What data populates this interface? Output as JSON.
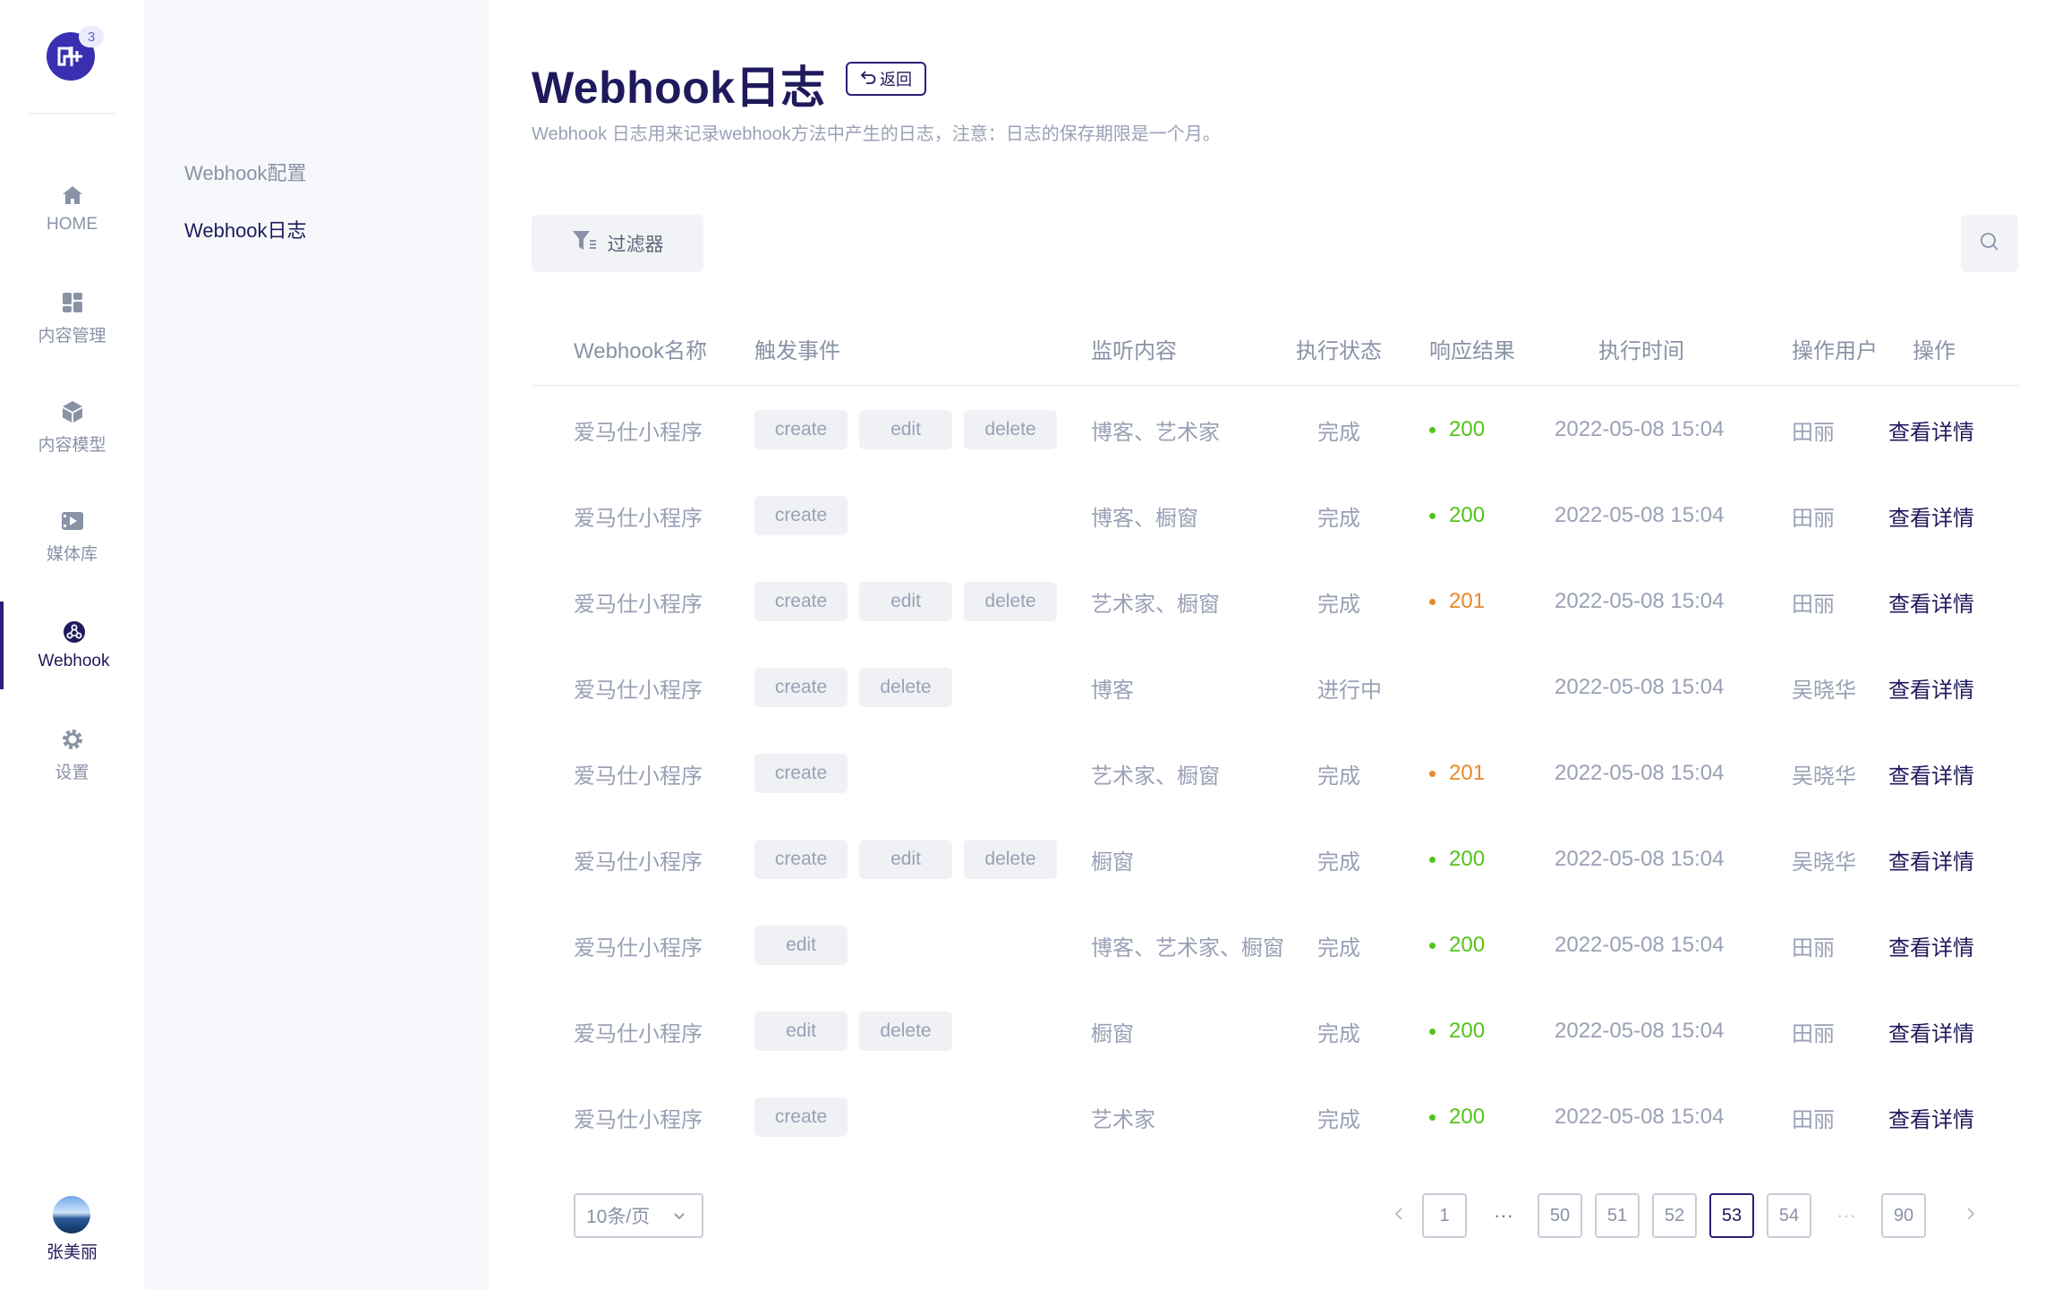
{
  "app": {
    "notification_count": "3",
    "colors": {
      "primary": "#2a1f7a",
      "success": "#52c41a",
      "warning": "#e8892b",
      "muted": "#9aa1b5"
    }
  },
  "rail": {
    "items": [
      {
        "label": "HOME",
        "icon": "home-icon"
      },
      {
        "label": "内容管理",
        "icon": "dashboard-icon"
      },
      {
        "label": "内容模型",
        "icon": "cube-icon"
      },
      {
        "label": "媒体库",
        "icon": "media-icon"
      },
      {
        "label": "Webhook",
        "icon": "webhook-icon",
        "active": true
      },
      {
        "label": "设置",
        "icon": "gear-icon"
      }
    ],
    "user_name": "张美丽"
  },
  "subnav": {
    "items": [
      {
        "label": "Webhook配置"
      },
      {
        "label": "Webhook日志",
        "active": true
      }
    ]
  },
  "header": {
    "title": "Webhook日志",
    "back_label": "返回",
    "subtitle": "Webhook 日志用来记录webhook方法中产生的日志，注意：日志的保存期限是一个月。"
  },
  "toolbar": {
    "filter_label": "过滤器",
    "search_icon": "search-icon"
  },
  "table": {
    "columns": [
      "Webhook名称",
      "触发事件",
      "监听内容",
      "执行状态",
      "响应结果",
      "执行时间",
      "操作用户",
      "操作"
    ],
    "rows": [
      {
        "name": "爱马仕小程序",
        "events": [
          "create",
          "edit",
          "delete"
        ],
        "content": "博客、艺术家",
        "status": "完成",
        "result": "200",
        "result_color": "#52c41a",
        "time": "2022-05-08 15:04",
        "user": "田丽",
        "action": "查看详情"
      },
      {
        "name": "爱马仕小程序",
        "events": [
          "create"
        ],
        "content": "博客、橱窗",
        "status": "完成",
        "result": "200",
        "result_color": "#52c41a",
        "time": "2022-05-08 15:04",
        "user": "田丽",
        "action": "查看详情"
      },
      {
        "name": "爱马仕小程序",
        "events": [
          "create",
          "edit",
          "delete"
        ],
        "content": "艺术家、橱窗",
        "status": "完成",
        "result": "201",
        "result_color": "#e8892b",
        "time": "2022-05-08 15:04",
        "user": "田丽",
        "action": "查看详情"
      },
      {
        "name": "爱马仕小程序",
        "events": [
          "create",
          "delete"
        ],
        "content": "博客",
        "status": "进行中",
        "result": "",
        "result_color": "",
        "time": "2022-05-08 15:04",
        "user": "吴晓华",
        "action": "查看详情"
      },
      {
        "name": "爱马仕小程序",
        "events": [
          "create"
        ],
        "content": "艺术家、橱窗",
        "status": "完成",
        "result": "201",
        "result_color": "#e8892b",
        "time": "2022-05-08 15:04",
        "user": "吴晓华",
        "action": "查看详情"
      },
      {
        "name": "爱马仕小程序",
        "events": [
          "create",
          "edit",
          "delete"
        ],
        "content": "橱窗",
        "status": "完成",
        "result": "200",
        "result_color": "#52c41a",
        "time": "2022-05-08 15:04",
        "user": "吴晓华",
        "action": "查看详情"
      },
      {
        "name": "爱马仕小程序",
        "events": [
          "edit"
        ],
        "content": "博客、艺术家、橱窗",
        "status": "完成",
        "result": "200",
        "result_color": "#52c41a",
        "time": "2022-05-08 15:04",
        "user": "田丽",
        "action": "查看详情"
      },
      {
        "name": "爱马仕小程序",
        "events": [
          "edit",
          "delete"
        ],
        "content": "橱窗",
        "status": "完成",
        "result": "200",
        "result_color": "#52c41a",
        "time": "2022-05-08 15:04",
        "user": "田丽",
        "action": "查看详情"
      },
      {
        "name": "爱马仕小程序",
        "events": [
          "create"
        ],
        "content": "艺术家",
        "status": "完成",
        "result": "200",
        "result_color": "#52c41a",
        "time": "2022-05-08 15:04",
        "user": "田丽",
        "action": "查看详情"
      }
    ]
  },
  "pagination": {
    "page_size": "10条/页",
    "pages": [
      {
        "type": "page",
        "label": "1"
      },
      {
        "type": "ellipsis",
        "label": "···"
      },
      {
        "type": "page",
        "label": "50"
      },
      {
        "type": "page",
        "label": "51"
      },
      {
        "type": "page",
        "label": "52"
      },
      {
        "type": "page",
        "label": "53",
        "current": true
      },
      {
        "type": "page",
        "label": "54"
      },
      {
        "type": "ellipsis",
        "label": "···",
        "faint": true
      },
      {
        "type": "page",
        "label": "90"
      }
    ]
  }
}
